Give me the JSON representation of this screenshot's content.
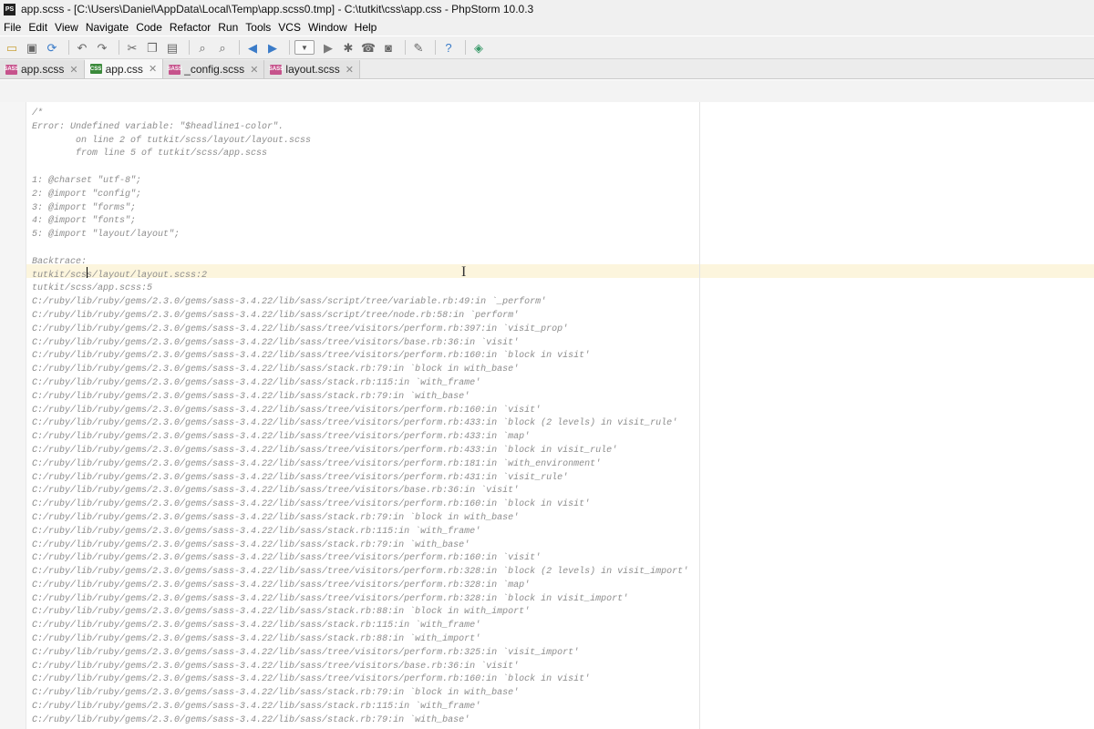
{
  "window": {
    "title": "app.scss - [C:\\Users\\Daniel\\AppData\\Local\\Temp\\app.scss0.tmp] - C:\\tutkit\\css\\app.css - PhpStorm 10.0.3",
    "app_icon_text": "PS"
  },
  "menu": [
    "File",
    "Edit",
    "View",
    "Navigate",
    "Code",
    "Refactor",
    "Run",
    "Tools",
    "VCS",
    "Window",
    "Help"
  ],
  "tabs": [
    {
      "label": "app.scss",
      "icon": "sass-file-icon",
      "icon_text": "SASS",
      "active": false
    },
    {
      "label": "app.css",
      "icon": "css-file-icon",
      "icon_text": "CSS",
      "active": true
    },
    {
      "label": "_config.scss",
      "icon": "sass-file-icon",
      "icon_text": "SASS",
      "active": false
    },
    {
      "label": "layout.scss",
      "icon": "sass-file-icon",
      "icon_text": "SASS",
      "active": false
    }
  ],
  "colors": {
    "sass_icon": "#c6538c",
    "css_icon": "#3b8a3b",
    "comment_text": "#8c8c8c",
    "caret_line": "#fcf5dd"
  },
  "editor": {
    "lines": [
      "/*",
      "Error: Undefined variable: \"$headline1-color\".",
      "        on line 2 of tutkit/scss/layout/layout.scss",
      "        from line 5 of tutkit/scss/app.scss",
      "",
      "1: @charset \"utf-8\";",
      "2: @import \"config\";",
      "3: @import \"forms\";",
      "4: @import \"fonts\";",
      "5: @import \"layout/layout\";",
      "",
      "Backtrace:",
      "tutkit/scss/layout/layout.scss:2",
      "tutkit/scss/app.scss:5",
      "C:/ruby/lib/ruby/gems/2.3.0/gems/sass-3.4.22/lib/sass/script/tree/variable.rb:49:in `_perform'",
      "C:/ruby/lib/ruby/gems/2.3.0/gems/sass-3.4.22/lib/sass/script/tree/node.rb:58:in `perform'",
      "C:/ruby/lib/ruby/gems/2.3.0/gems/sass-3.4.22/lib/sass/tree/visitors/perform.rb:397:in `visit_prop'",
      "C:/ruby/lib/ruby/gems/2.3.0/gems/sass-3.4.22/lib/sass/tree/visitors/base.rb:36:in `visit'",
      "C:/ruby/lib/ruby/gems/2.3.0/gems/sass-3.4.22/lib/sass/tree/visitors/perform.rb:160:in `block in visit'",
      "C:/ruby/lib/ruby/gems/2.3.0/gems/sass-3.4.22/lib/sass/stack.rb:79:in `block in with_base'",
      "C:/ruby/lib/ruby/gems/2.3.0/gems/sass-3.4.22/lib/sass/stack.rb:115:in `with_frame'",
      "C:/ruby/lib/ruby/gems/2.3.0/gems/sass-3.4.22/lib/sass/stack.rb:79:in `with_base'",
      "C:/ruby/lib/ruby/gems/2.3.0/gems/sass-3.4.22/lib/sass/tree/visitors/perform.rb:160:in `visit'",
      "C:/ruby/lib/ruby/gems/2.3.0/gems/sass-3.4.22/lib/sass/tree/visitors/perform.rb:433:in `block (2 levels) in visit_rule'",
      "C:/ruby/lib/ruby/gems/2.3.0/gems/sass-3.4.22/lib/sass/tree/visitors/perform.rb:433:in `map'",
      "C:/ruby/lib/ruby/gems/2.3.0/gems/sass-3.4.22/lib/sass/tree/visitors/perform.rb:433:in `block in visit_rule'",
      "C:/ruby/lib/ruby/gems/2.3.0/gems/sass-3.4.22/lib/sass/tree/visitors/perform.rb:181:in `with_environment'",
      "C:/ruby/lib/ruby/gems/2.3.0/gems/sass-3.4.22/lib/sass/tree/visitors/perform.rb:431:in `visit_rule'",
      "C:/ruby/lib/ruby/gems/2.3.0/gems/sass-3.4.22/lib/sass/tree/visitors/base.rb:36:in `visit'",
      "C:/ruby/lib/ruby/gems/2.3.0/gems/sass-3.4.22/lib/sass/tree/visitors/perform.rb:160:in `block in visit'",
      "C:/ruby/lib/ruby/gems/2.3.0/gems/sass-3.4.22/lib/sass/stack.rb:79:in `block in with_base'",
      "C:/ruby/lib/ruby/gems/2.3.0/gems/sass-3.4.22/lib/sass/stack.rb:115:in `with_frame'",
      "C:/ruby/lib/ruby/gems/2.3.0/gems/sass-3.4.22/lib/sass/stack.rb:79:in `with_base'",
      "C:/ruby/lib/ruby/gems/2.3.0/gems/sass-3.4.22/lib/sass/tree/visitors/perform.rb:160:in `visit'",
      "C:/ruby/lib/ruby/gems/2.3.0/gems/sass-3.4.22/lib/sass/tree/visitors/perform.rb:328:in `block (2 levels) in visit_import'",
      "C:/ruby/lib/ruby/gems/2.3.0/gems/sass-3.4.22/lib/sass/tree/visitors/perform.rb:328:in `map'",
      "C:/ruby/lib/ruby/gems/2.3.0/gems/sass-3.4.22/lib/sass/tree/visitors/perform.rb:328:in `block in visit_import'",
      "C:/ruby/lib/ruby/gems/2.3.0/gems/sass-3.4.22/lib/sass/stack.rb:88:in `block in with_import'",
      "C:/ruby/lib/ruby/gems/2.3.0/gems/sass-3.4.22/lib/sass/stack.rb:115:in `with_frame'",
      "C:/ruby/lib/ruby/gems/2.3.0/gems/sass-3.4.22/lib/sass/stack.rb:88:in `with_import'",
      "C:/ruby/lib/ruby/gems/2.3.0/gems/sass-3.4.22/lib/sass/tree/visitors/perform.rb:325:in `visit_import'",
      "C:/ruby/lib/ruby/gems/2.3.0/gems/sass-3.4.22/lib/sass/tree/visitors/base.rb:36:in `visit'",
      "C:/ruby/lib/ruby/gems/2.3.0/gems/sass-3.4.22/lib/sass/tree/visitors/perform.rb:160:in `block in visit'",
      "C:/ruby/lib/ruby/gems/2.3.0/gems/sass-3.4.22/lib/sass/stack.rb:79:in `block in with_base'",
      "C:/ruby/lib/ruby/gems/2.3.0/gems/sass-3.4.22/lib/sass/stack.rb:115:in `with_frame'",
      "C:/ruby/lib/ruby/gems/2.3.0/gems/sass-3.4.22/lib/sass/stack.rb:79:in `with_base'"
    ]
  }
}
